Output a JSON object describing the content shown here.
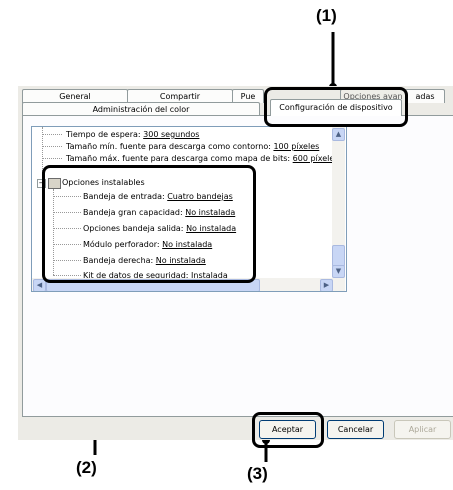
{
  "callouts": {
    "c1": "(1)",
    "c2": "(2)",
    "c3": "(3)"
  },
  "tabs": {
    "row1": [
      "General",
      "Compartir",
      "Pue",
      "Opciones avan",
      "adas"
    ],
    "row2": [
      "Administración del color",
      "Configuración de dispositivo"
    ]
  },
  "tree": {
    "items": [
      {
        "label": "Tiempo de espera:",
        "value": "300 segundos"
      },
      {
        "label": "Tamaño mín. fuente para descarga como contorno:",
        "value": "100 píxeles"
      },
      {
        "label": "Tamaño máx. fuente para descarga como mapa de bits:",
        "value": "600 píxele"
      }
    ],
    "group_label": "Opciones instalables",
    "options": [
      {
        "label": "Bandeja de entrada:",
        "value": "Cuatro bandejas"
      },
      {
        "label": "Bandeja gran capacidad:",
        "value": "No instalada"
      },
      {
        "label": "Opciones bandeja salida:",
        "value": "No instalada"
      },
      {
        "label": "Módulo perforador:",
        "value": "No instalada"
      },
      {
        "label": "Bandeja derecha:",
        "value": "No instalada"
      },
      {
        "label": "Kit de datos de seguridad:",
        "value": "Instalada"
      }
    ]
  },
  "buttons": {
    "accept": "Aceptar",
    "cancel": "Cancelar",
    "apply": "Aplicar"
  }
}
